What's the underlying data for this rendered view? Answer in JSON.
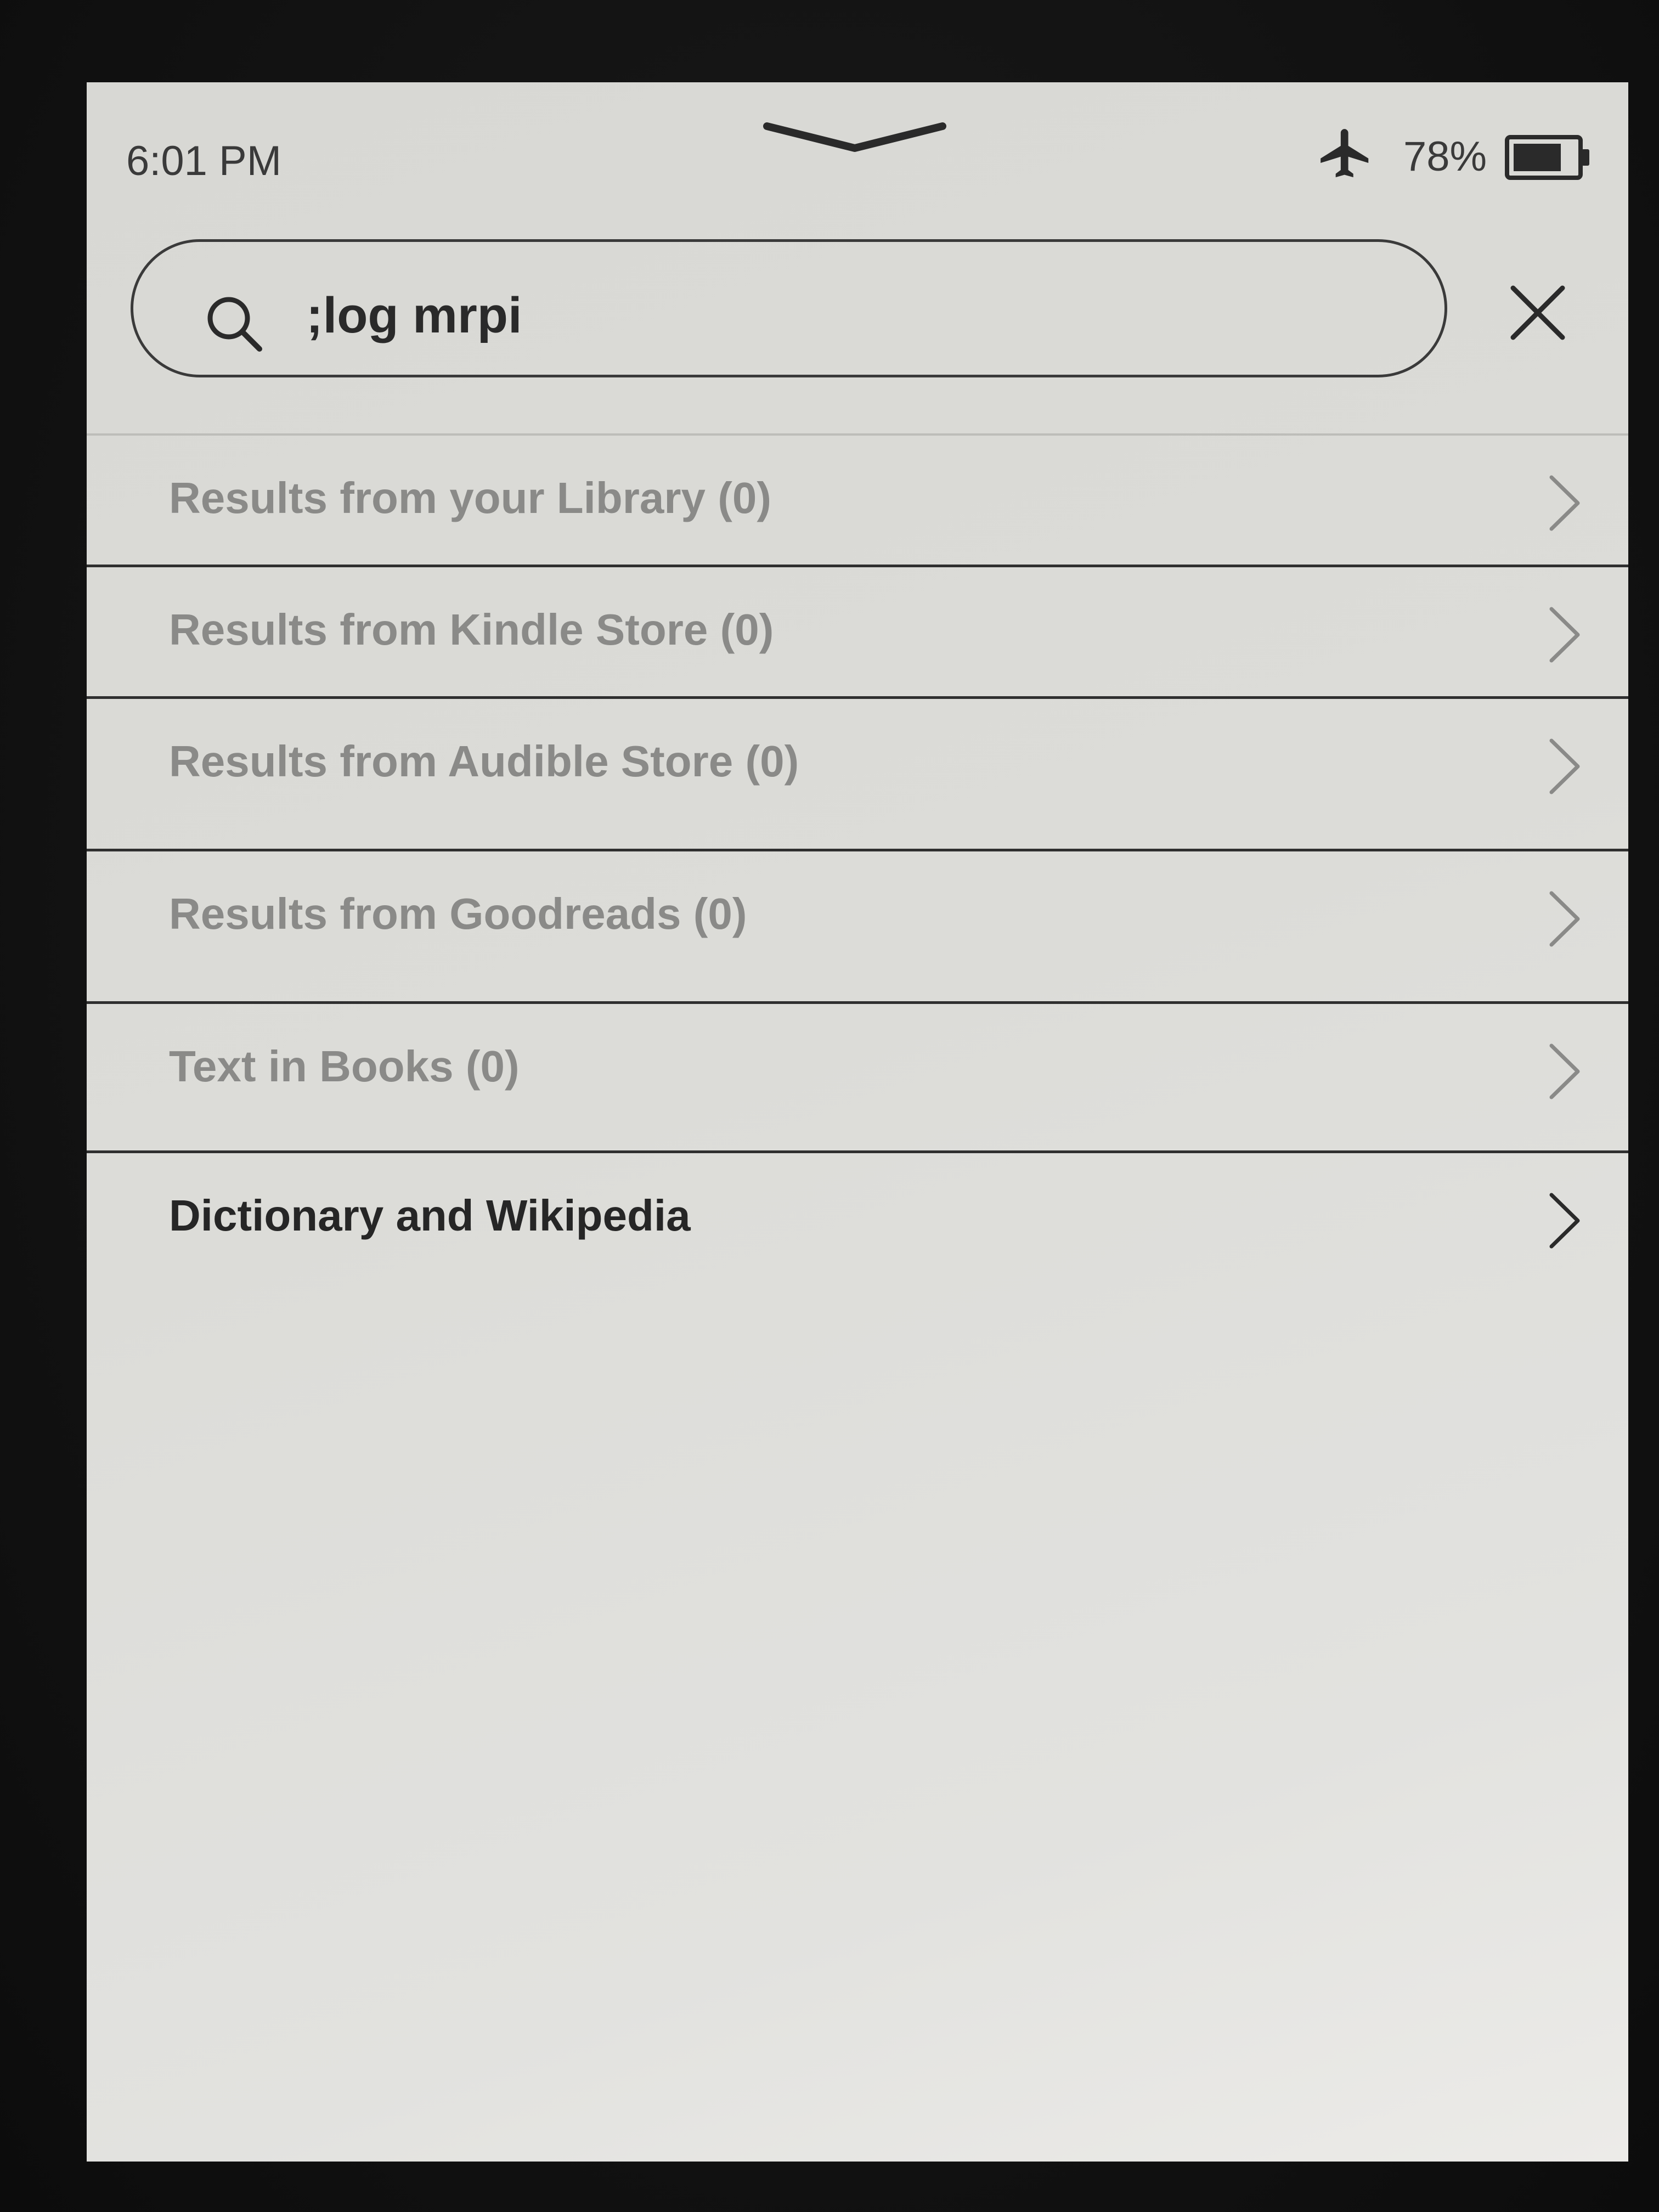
{
  "status_bar": {
    "time": "6:01 PM",
    "battery_percent": "78%",
    "battery_level": 0.78,
    "airplane_mode_icon": "airplane-icon"
  },
  "search": {
    "query": ";log mrpi",
    "icon": "search-icon",
    "clear_icon": "close-icon"
  },
  "results": [
    {
      "label": "Results from your Library (0)",
      "enabled": false
    },
    {
      "label": "Results from Kindle Store (0)",
      "enabled": false
    },
    {
      "label": "Results from Audible Store (0)",
      "enabled": false
    },
    {
      "label": "Results from Goodreads (0)",
      "enabled": false
    },
    {
      "label": "Text in Books (0)",
      "enabled": false
    },
    {
      "label": "Dictionary and Wikipedia",
      "enabled": true
    }
  ],
  "colors": {
    "screen_bg": "#dcdcd8",
    "text_disabled": "#8a8a88",
    "text_active": "#262626"
  }
}
